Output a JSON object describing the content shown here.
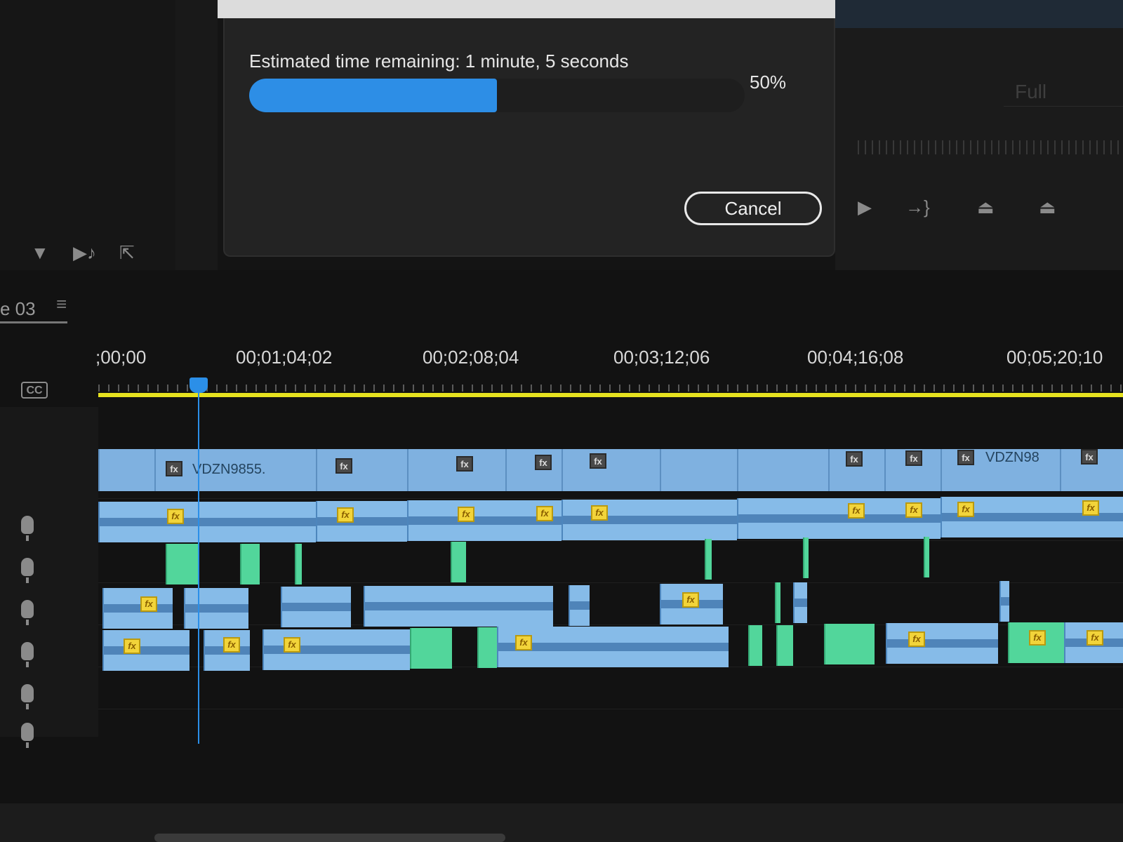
{
  "dialog": {
    "time_label": "Estimated time remaining: 1 minute, 5 seconds",
    "progress_text": "50%",
    "progress_fraction": 0.5,
    "cancel_label": "Cancel"
  },
  "program_monitor": {
    "zoom_label": "Full",
    "transport_icons": [
      "play-icon",
      "go-to-out-icon",
      "lift-icon",
      "extract-icon"
    ]
  },
  "source_panel": {
    "icons": [
      "filter-icon",
      "insert-icon",
      "export-icon"
    ]
  },
  "sequence": {
    "tab_label": "e 03",
    "menu_icon": "hamburger-icon",
    "timecodes": [
      ";00;00",
      "00;01;04;02",
      "00;02;08;04",
      "00;03;12;06",
      "00;04;16;08",
      "00;05;20;10"
    ],
    "cc_label": "CC",
    "clip_names": [
      "VDZN9855.",
      "VDZN98"
    ],
    "fx_label": "fx"
  },
  "colors": {
    "progress_fill": "#2d8ee6",
    "work_area_bar": "#e6e21f",
    "video_clip": "#7fb1e0",
    "audio_clip": "#6aa5dc",
    "nested_clip": "#52d69b",
    "fx_badge": "#f2d43a",
    "playhead": "#2b8fe8"
  }
}
